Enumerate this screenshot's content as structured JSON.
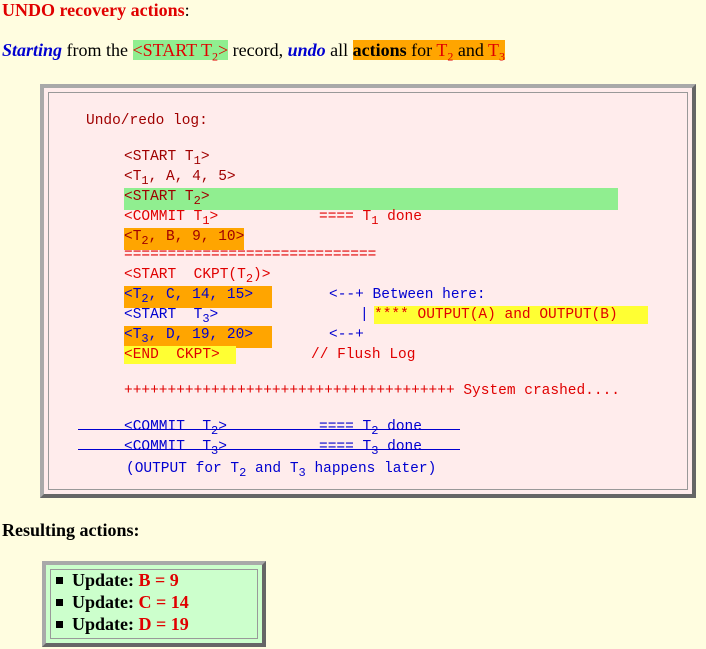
{
  "heading": "UNDO recovery actions",
  "heading_colon": ":",
  "intro": {
    "w1": "Starting",
    "w2": " from the ",
    "rec_a": "<START T",
    "rec_sub": "2",
    "rec_b": ">",
    "w3": " record, ",
    "w4": "undo",
    "w5": " all ",
    "w6": "actions",
    "w7": " for ",
    "t2_a": "T",
    "t2_sub": "2",
    "w8": " and ",
    "t3_a": "T",
    "t3_sub": "3"
  },
  "log": {
    "title": "Undo/redo log:",
    "l1_a": "<START T",
    "l1_s": "1",
    "l1_b": ">",
    "l2_a": "<T",
    "l2_s": "1",
    "l2_b": ", A, 4, 5>",
    "l3_a": "<START T",
    "l3_s": "2",
    "l3_b": ">",
    "l4_a": "<COMMIT T",
    "l4_s": "1",
    "l4_b": ">",
    "l4_c": "==== T",
    "l4_cs": "1",
    "l4_d": " done",
    "l5_a": "<T",
    "l5_s": "2",
    "l5_b": ", B, 9, 10>",
    "l6": "=============================",
    "l7_a": "<START  CKPT(T",
    "l7_s": "2",
    "l7_b": ")>",
    "l8_a": "<T",
    "l8_s": "2",
    "l8_b": ", C, 14, 15>",
    "l8_c": "<--+ Between here:",
    "l9_a": "<START  T",
    "l9_s": "3",
    "l9_b": ">",
    "l9_c": "|",
    "l9_d": "**** OUTPUT(A) and OUTPUT(B)",
    "l10_a": "<T",
    "l10_s": "3",
    "l10_b": ", D, 19, 20>",
    "l10_c": "<--+",
    "l11_a": "<END  CKPT>",
    "l11_c": "// Flush Log",
    "crash": "++++++++++++++++++++++++++++++++++++++ System crashed....",
    "c1_a": "<COMMIT  T",
    "c1_s": "2",
    "c1_b": ">",
    "c1_c": "==== T",
    "c1_cs": "2",
    "c1_d": " done",
    "c2_a": "<COMMIT  T",
    "c2_s": "3",
    "c2_b": ">",
    "c2_c": "==== T",
    "c2_cs": "3",
    "c2_d": " done",
    "note_a": "(OUTPUT for T",
    "note_s1": "2",
    "note_b": " and T",
    "note_s2": "3",
    "note_c": " happens later)"
  },
  "resulting": "Resulting actions:",
  "actions": [
    {
      "label": "Update: ",
      "value": "B = 9"
    },
    {
      "label": "Update: ",
      "value": "C = 14"
    },
    {
      "label": "Update: ",
      "value": "D = 19"
    }
  ],
  "colors": {
    "red": "#e00000",
    "blue": "#0000d0",
    "green_hl": "#90ee90",
    "orange_hl": "#ffa500",
    "yellow_hl": "#ffff33"
  }
}
